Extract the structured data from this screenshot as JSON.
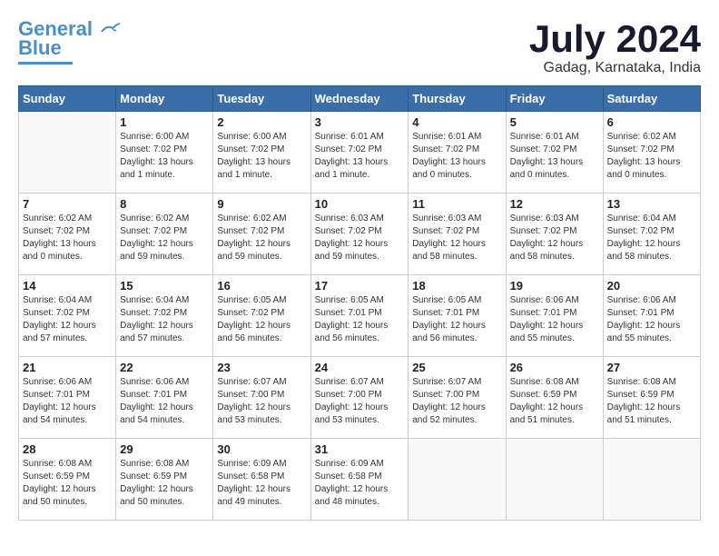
{
  "logo": {
    "line1": "General",
    "line2": "Blue"
  },
  "title": "July 2024",
  "location": "Gadag, Karnataka, India",
  "days_of_week": [
    "Sunday",
    "Monday",
    "Tuesday",
    "Wednesday",
    "Thursday",
    "Friday",
    "Saturday"
  ],
  "weeks": [
    [
      {
        "num": "",
        "info": ""
      },
      {
        "num": "1",
        "info": "Sunrise: 6:00 AM\nSunset: 7:02 PM\nDaylight: 13 hours and 1 minute."
      },
      {
        "num": "2",
        "info": "Sunrise: 6:00 AM\nSunset: 7:02 PM\nDaylight: 13 hours and 1 minute."
      },
      {
        "num": "3",
        "info": "Sunrise: 6:01 AM\nSunset: 7:02 PM\nDaylight: 13 hours and 1 minute."
      },
      {
        "num": "4",
        "info": "Sunrise: 6:01 AM\nSunset: 7:02 PM\nDaylight: 13 hours and 0 minutes."
      },
      {
        "num": "5",
        "info": "Sunrise: 6:01 AM\nSunset: 7:02 PM\nDaylight: 13 hours and 0 minutes."
      },
      {
        "num": "6",
        "info": "Sunrise: 6:02 AM\nSunset: 7:02 PM\nDaylight: 13 hours and 0 minutes."
      }
    ],
    [
      {
        "num": "7",
        "info": "Sunrise: 6:02 AM\nSunset: 7:02 PM\nDaylight: 13 hours and 0 minutes."
      },
      {
        "num": "8",
        "info": "Sunrise: 6:02 AM\nSunset: 7:02 PM\nDaylight: 12 hours and 59 minutes."
      },
      {
        "num": "9",
        "info": "Sunrise: 6:02 AM\nSunset: 7:02 PM\nDaylight: 12 hours and 59 minutes."
      },
      {
        "num": "10",
        "info": "Sunrise: 6:03 AM\nSunset: 7:02 PM\nDaylight: 12 hours and 59 minutes."
      },
      {
        "num": "11",
        "info": "Sunrise: 6:03 AM\nSunset: 7:02 PM\nDaylight: 12 hours and 58 minutes."
      },
      {
        "num": "12",
        "info": "Sunrise: 6:03 AM\nSunset: 7:02 PM\nDaylight: 12 hours and 58 minutes."
      },
      {
        "num": "13",
        "info": "Sunrise: 6:04 AM\nSunset: 7:02 PM\nDaylight: 12 hours and 58 minutes."
      }
    ],
    [
      {
        "num": "14",
        "info": "Sunrise: 6:04 AM\nSunset: 7:02 PM\nDaylight: 12 hours and 57 minutes."
      },
      {
        "num": "15",
        "info": "Sunrise: 6:04 AM\nSunset: 7:02 PM\nDaylight: 12 hours and 57 minutes."
      },
      {
        "num": "16",
        "info": "Sunrise: 6:05 AM\nSunset: 7:02 PM\nDaylight: 12 hours and 56 minutes."
      },
      {
        "num": "17",
        "info": "Sunrise: 6:05 AM\nSunset: 7:01 PM\nDaylight: 12 hours and 56 minutes."
      },
      {
        "num": "18",
        "info": "Sunrise: 6:05 AM\nSunset: 7:01 PM\nDaylight: 12 hours and 56 minutes."
      },
      {
        "num": "19",
        "info": "Sunrise: 6:06 AM\nSunset: 7:01 PM\nDaylight: 12 hours and 55 minutes."
      },
      {
        "num": "20",
        "info": "Sunrise: 6:06 AM\nSunset: 7:01 PM\nDaylight: 12 hours and 55 minutes."
      }
    ],
    [
      {
        "num": "21",
        "info": "Sunrise: 6:06 AM\nSunset: 7:01 PM\nDaylight: 12 hours and 54 minutes."
      },
      {
        "num": "22",
        "info": "Sunrise: 6:06 AM\nSunset: 7:01 PM\nDaylight: 12 hours and 54 minutes."
      },
      {
        "num": "23",
        "info": "Sunrise: 6:07 AM\nSunset: 7:00 PM\nDaylight: 12 hours and 53 minutes."
      },
      {
        "num": "24",
        "info": "Sunrise: 6:07 AM\nSunset: 7:00 PM\nDaylight: 12 hours and 53 minutes."
      },
      {
        "num": "25",
        "info": "Sunrise: 6:07 AM\nSunset: 7:00 PM\nDaylight: 12 hours and 52 minutes."
      },
      {
        "num": "26",
        "info": "Sunrise: 6:08 AM\nSunset: 6:59 PM\nDaylight: 12 hours and 51 minutes."
      },
      {
        "num": "27",
        "info": "Sunrise: 6:08 AM\nSunset: 6:59 PM\nDaylight: 12 hours and 51 minutes."
      }
    ],
    [
      {
        "num": "28",
        "info": "Sunrise: 6:08 AM\nSunset: 6:59 PM\nDaylight: 12 hours and 50 minutes."
      },
      {
        "num": "29",
        "info": "Sunrise: 6:08 AM\nSunset: 6:59 PM\nDaylight: 12 hours and 50 minutes."
      },
      {
        "num": "30",
        "info": "Sunrise: 6:09 AM\nSunset: 6:58 PM\nDaylight: 12 hours and 49 minutes."
      },
      {
        "num": "31",
        "info": "Sunrise: 6:09 AM\nSunset: 6:58 PM\nDaylight: 12 hours and 48 minutes."
      },
      {
        "num": "",
        "info": ""
      },
      {
        "num": "",
        "info": ""
      },
      {
        "num": "",
        "info": ""
      }
    ]
  ]
}
